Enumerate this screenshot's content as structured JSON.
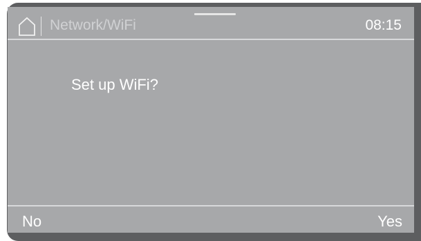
{
  "header": {
    "home_icon": "home-icon",
    "breadcrumb": "Network/WiFi",
    "time": "08:15"
  },
  "dialog": {
    "prompt": "Set up WiFi?"
  },
  "footer": {
    "left_label": "No",
    "right_label": "Yes"
  },
  "colors": {
    "screen_background": "#a7a8aa",
    "bezel": "#5d5e60",
    "text": "#ffffff",
    "divider": "#d8d9db"
  }
}
